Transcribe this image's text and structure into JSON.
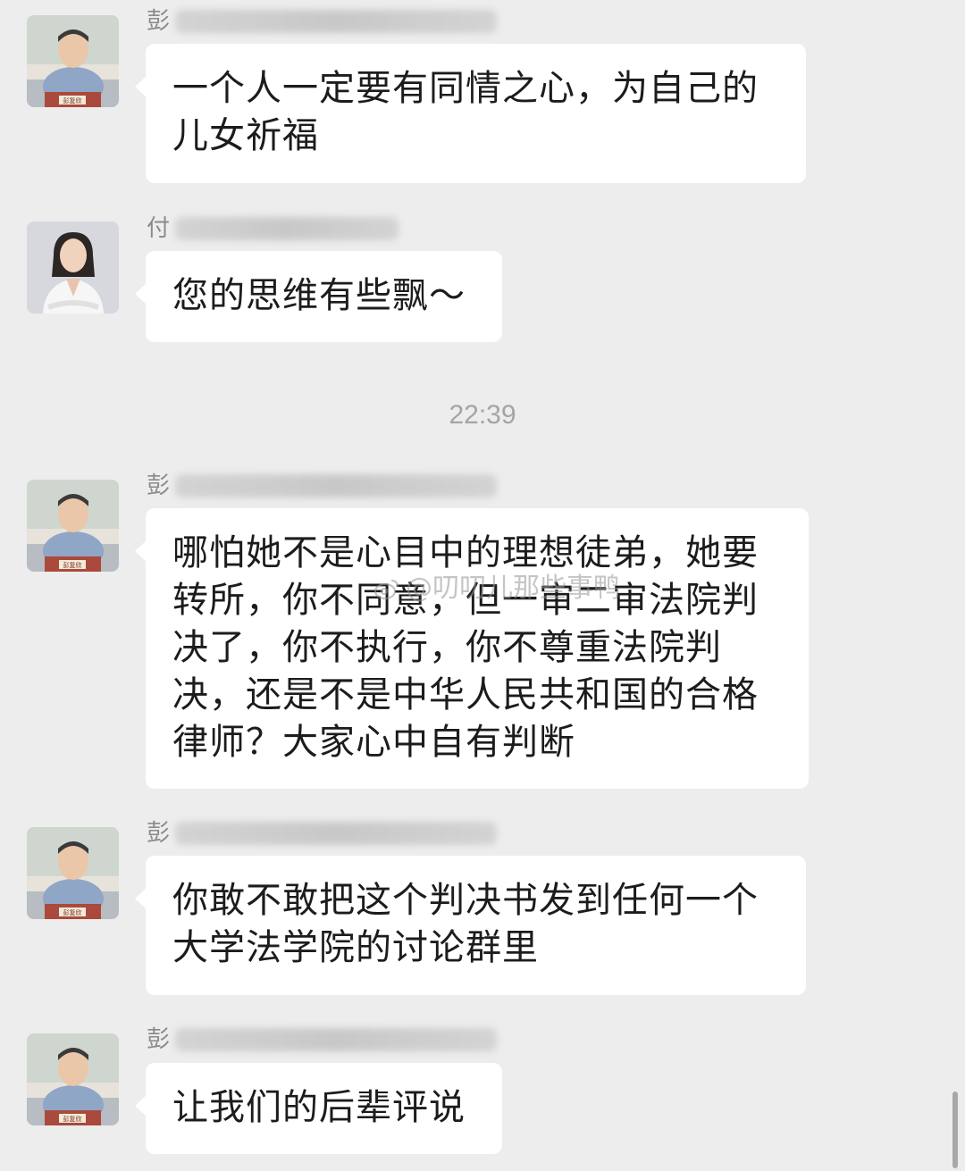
{
  "messages": [
    {
      "sender_visible": "彭",
      "text": "一个人一定要有同情之心，为自己的儿女祈福"
    },
    {
      "sender_visible": "付",
      "text": "您的思维有些飘～"
    },
    {
      "sender_visible": "彭",
      "text": "哪怕她不是心目中的理想徒弟，她要转所，你不同意，但一审二审法院判决了，你不执行，你不尊重法院判决，还是不是中华人民共和国的合格律师？大家心中自有判断"
    },
    {
      "sender_visible": "彭",
      "text": "你敢不敢把这个判决书发到任何一个大学法学院的讨论群里"
    },
    {
      "sender_visible": "彭",
      "text": "让我们的后辈评说"
    }
  ],
  "timestamp": "22:39",
  "watermark": "@叨叨儿那些事鸭",
  "avatar_nameplate": "彭复欣",
  "icons": {
    "watermark_icon": "weibo-icon"
  },
  "colors": {
    "background": "#ededed",
    "bubble": "#ffffff",
    "text": "#1c1c1c",
    "meta": "#a4a4a4"
  }
}
